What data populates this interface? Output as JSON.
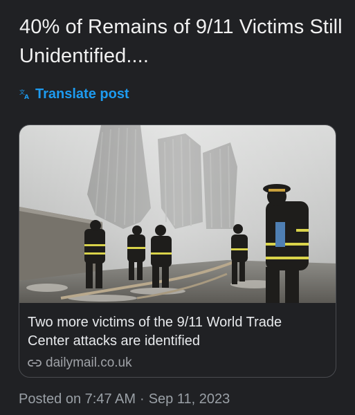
{
  "post": {
    "text": "40% of Remains of 9/11 Victims Still Unidentified....",
    "translate_label": "Translate post"
  },
  "link_card": {
    "image_icon": "news-photo",
    "title": "Two more victims of the 9/11 World Trade Center attacks are identified",
    "domain": "dailymail.co.uk",
    "domain_icon": "link-icon"
  },
  "meta": {
    "posted_label": "Posted on",
    "time": "7:47 AM",
    "separator": "·",
    "date": "Sep 11, 2023"
  },
  "colors": {
    "background": "#202124",
    "link_accent": "#1d9bf0",
    "secondary_text": "#9aa0a6",
    "card_border": "#4a4c50"
  }
}
